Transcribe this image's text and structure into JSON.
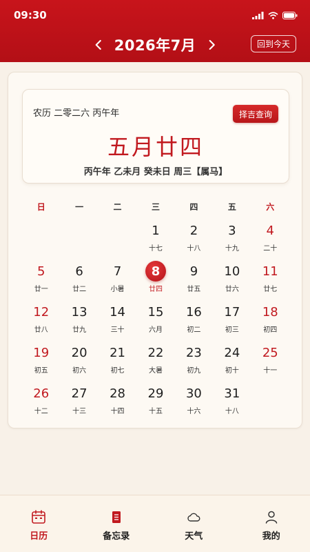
{
  "status_bar": {
    "time": "09:30"
  },
  "header": {
    "month_title": "2026年7月",
    "today_button": "回到今天"
  },
  "info_card": {
    "lunar_year": "农历 二零二六 丙午年",
    "auspicious_button": "择吉查询",
    "lunar_date": "五月廿四",
    "ganzhi": "丙午年 乙未月 癸未日 周三【属马】"
  },
  "weekdays": [
    "日",
    "一",
    "二",
    "三",
    "四",
    "五",
    "六"
  ],
  "calendar": {
    "leading_blanks": 3,
    "selected_day": 8,
    "days": [
      {
        "num": "1",
        "lunar": "十七"
      },
      {
        "num": "2",
        "lunar": "十八"
      },
      {
        "num": "3",
        "lunar": "十九"
      },
      {
        "num": "4",
        "lunar": "二十"
      },
      {
        "num": "5",
        "lunar": "廿一"
      },
      {
        "num": "6",
        "lunar": "廿二"
      },
      {
        "num": "7",
        "lunar": "小暑"
      },
      {
        "num": "8",
        "lunar": "廿四"
      },
      {
        "num": "9",
        "lunar": "廿五"
      },
      {
        "num": "10",
        "lunar": "廿六"
      },
      {
        "num": "11",
        "lunar": "廿七"
      },
      {
        "num": "12",
        "lunar": "廿八"
      },
      {
        "num": "13",
        "lunar": "廿九"
      },
      {
        "num": "14",
        "lunar": "三十"
      },
      {
        "num": "15",
        "lunar": "六月"
      },
      {
        "num": "16",
        "lunar": "初二"
      },
      {
        "num": "17",
        "lunar": "初三"
      },
      {
        "num": "18",
        "lunar": "初四"
      },
      {
        "num": "19",
        "lunar": "初五"
      },
      {
        "num": "20",
        "lunar": "初六"
      },
      {
        "num": "21",
        "lunar": "初七"
      },
      {
        "num": "22",
        "lunar": "大暑"
      },
      {
        "num": "23",
        "lunar": "初九"
      },
      {
        "num": "24",
        "lunar": "初十"
      },
      {
        "num": "25",
        "lunar": "十一"
      },
      {
        "num": "26",
        "lunar": "十二"
      },
      {
        "num": "27",
        "lunar": "十三"
      },
      {
        "num": "28",
        "lunar": "十四"
      },
      {
        "num": "29",
        "lunar": "十五"
      },
      {
        "num": "30",
        "lunar": "十六"
      },
      {
        "num": "31",
        "lunar": "十八"
      }
    ]
  },
  "tabs": [
    {
      "label": "日历",
      "icon": "calendar-icon",
      "active": true
    },
    {
      "label": "备忘录",
      "icon": "memo-icon",
      "active": false
    },
    {
      "label": "天气",
      "icon": "weather-icon",
      "active": false
    },
    {
      "label": "我的",
      "icon": "user-icon",
      "active": false
    }
  ],
  "colors": {
    "brand_red": "#c1191f",
    "header_red": "#c8141b",
    "background": "#f8f1e8"
  }
}
